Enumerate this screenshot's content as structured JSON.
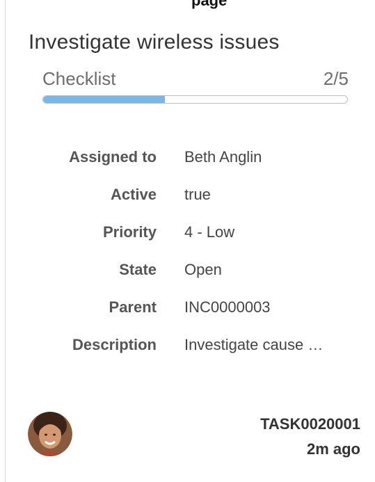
{
  "header_clip": "page",
  "card": {
    "title": "Investigate wireless issues",
    "checklist": {
      "label": "Checklist",
      "count": "2/5",
      "progress": 0.4,
      "fill_color": "#79b6ea"
    },
    "fields": [
      {
        "label": "Assigned to",
        "value": "Beth Anglin"
      },
      {
        "label": "Active",
        "value": "true"
      },
      {
        "label": "Priority",
        "value": "4 - Low"
      },
      {
        "label": "State",
        "value": "Open"
      },
      {
        "label": "Parent",
        "value": "INC0000003"
      },
      {
        "label": "Description",
        "value": "Investigate cause …"
      }
    ],
    "footer": {
      "avatar_icon": "user-avatar",
      "task_number": "TASK0020001",
      "updated": "2m ago"
    }
  }
}
